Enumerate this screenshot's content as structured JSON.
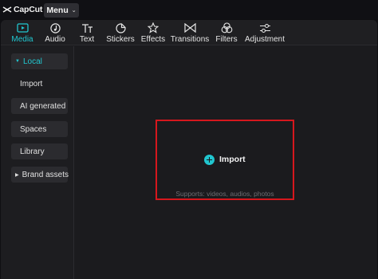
{
  "app": {
    "logo_text": "CapCut",
    "menu_label": "Menu"
  },
  "toolbar": {
    "tabs": [
      {
        "label": "Media",
        "icon": "media-icon",
        "active": true
      },
      {
        "label": "Audio",
        "icon": "audio-icon",
        "active": false
      },
      {
        "label": "Text",
        "icon": "text-icon",
        "active": false
      },
      {
        "label": "Stickers",
        "icon": "stickers-icon",
        "active": false
      },
      {
        "label": "Effects",
        "icon": "effects-icon",
        "active": false
      },
      {
        "label": "Transitions",
        "icon": "transitions-icon",
        "active": false
      },
      {
        "label": "Filters",
        "icon": "filters-icon",
        "active": false
      },
      {
        "label": "Adjustment",
        "icon": "adjustment-icon",
        "active": false
      }
    ]
  },
  "sidebar": {
    "items": [
      {
        "label": "Local",
        "expanded": true,
        "selected": true
      },
      {
        "label": "Import"
      },
      {
        "label": "AI generated"
      },
      {
        "label": "Spaces"
      },
      {
        "label": "Library"
      },
      {
        "label": "Brand assets",
        "expanded": false
      }
    ]
  },
  "content": {
    "import_label": "Import",
    "supports_text": "Supports: videos, audios, photos"
  },
  "colors": {
    "accent": "#21c6cf",
    "highlight": "#d6171d",
    "background": "#1b1b1e"
  }
}
